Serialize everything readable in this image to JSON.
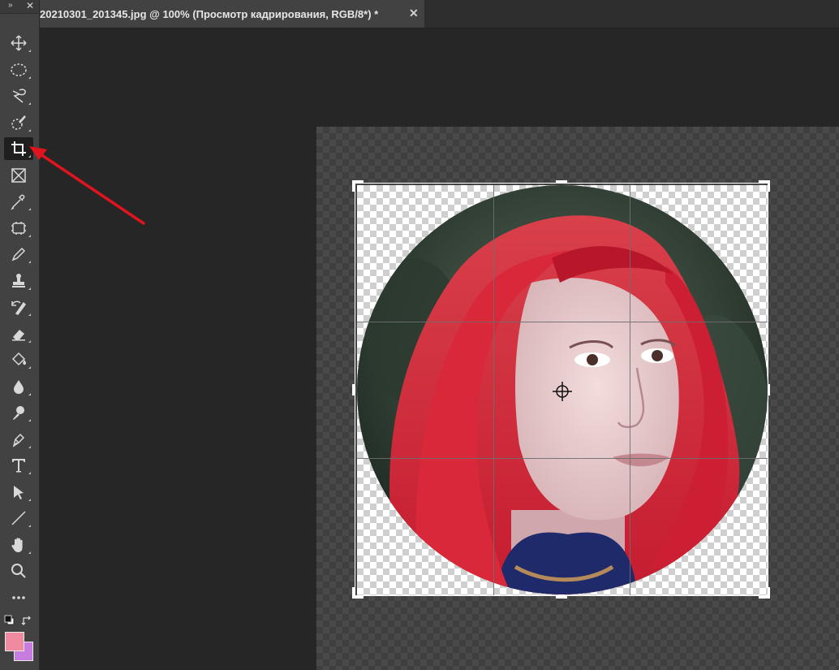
{
  "toolbox": {
    "collapse_glyph": "»",
    "close_glyph": "✕",
    "tools": [
      {
        "name": "move-tool",
        "icon": "move-icon"
      },
      {
        "name": "elliptical-marquee-tool",
        "icon": "ellipse-marquee-icon"
      },
      {
        "name": "lasso-tool",
        "icon": "lasso-icon"
      },
      {
        "name": "quick-selection-tool",
        "icon": "quick-select-icon"
      },
      {
        "name": "crop-tool",
        "icon": "crop-icon",
        "active": true
      },
      {
        "name": "frame-tool",
        "icon": "frame-icon"
      },
      {
        "name": "eyedropper-tool",
        "icon": "eyedropper-icon"
      },
      {
        "name": "healing-brush-tool",
        "icon": "bandage-icon"
      },
      {
        "name": "brush-tool",
        "icon": "pencil-icon"
      },
      {
        "name": "clone-stamp-tool",
        "icon": "stamp-icon"
      },
      {
        "name": "history-brush-tool",
        "icon": "history-brush-icon"
      },
      {
        "name": "eraser-tool",
        "icon": "eraser-icon"
      },
      {
        "name": "paint-bucket-tool",
        "icon": "bucket-icon"
      },
      {
        "name": "blur-tool",
        "icon": "drop-icon"
      },
      {
        "name": "dodge-tool",
        "icon": "dodge-icon"
      },
      {
        "name": "pen-tool",
        "icon": "pen-icon"
      },
      {
        "name": "type-tool",
        "icon": "type-icon"
      },
      {
        "name": "path-selection-tool",
        "icon": "arrow-select-icon"
      },
      {
        "name": "line-tool",
        "icon": "line-icon"
      },
      {
        "name": "hand-tool",
        "icon": "hand-icon"
      },
      {
        "name": "zoom-tool",
        "icon": "zoom-icon"
      },
      {
        "name": "edit-toolbar",
        "icon": "more-icon"
      }
    ],
    "foreground_color": "#f08aa0",
    "background_color": "#c77ce0"
  },
  "tab": {
    "title": "20210301_201345.jpg @ 100% (Просмотр кадрирования, RGB/8*) *",
    "close_glyph": "✕"
  },
  "colors": {
    "annotation_arrow": "#e0141e",
    "crop_border": "#ffffff"
  }
}
